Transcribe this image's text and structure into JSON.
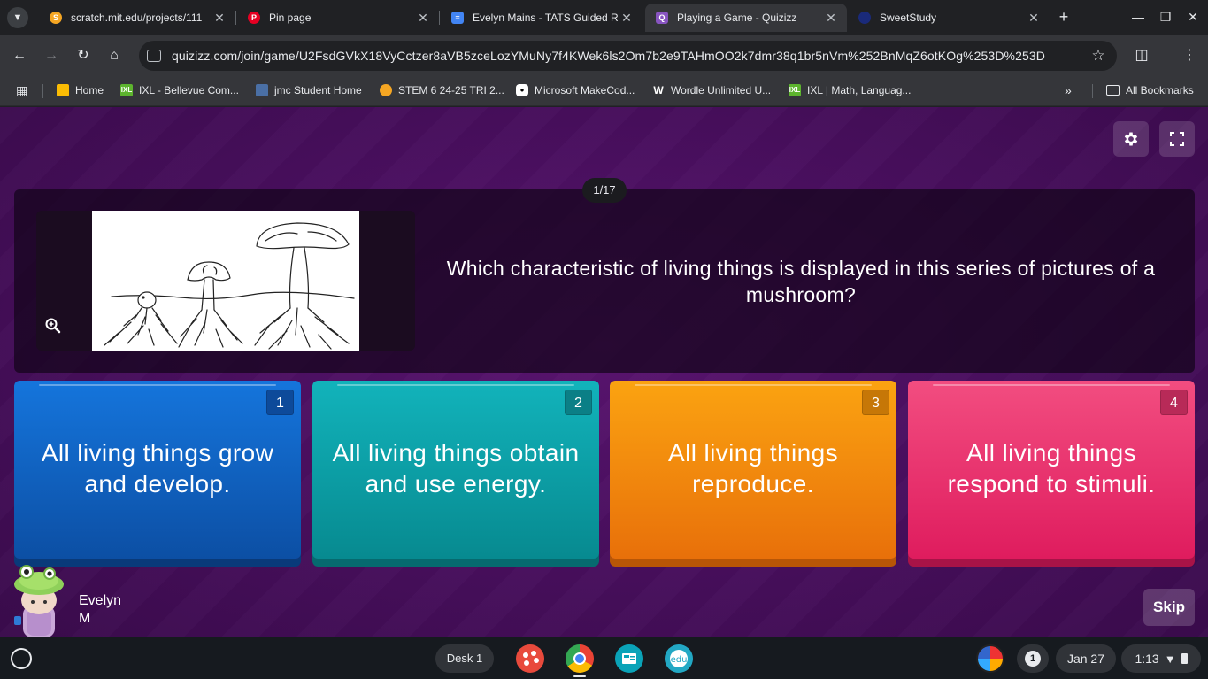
{
  "browser": {
    "tabs": [
      {
        "title": "scratch.mit.edu/projects/111",
        "favicon_color": "#f5a623",
        "active": false
      },
      {
        "title": "Pin page",
        "favicon_color": "#e60023",
        "active": false
      },
      {
        "title": "Evelyn Mains - TATS Guided R",
        "favicon_color": "#4285f4",
        "active": false
      },
      {
        "title": "Playing a Game - Quizizz",
        "favicon_color": "#8854c0",
        "active": true
      },
      {
        "title": "SweetStudy",
        "favicon_color": "#1a2a7a",
        "active": false
      }
    ],
    "url": "quizizz.com/join/game/U2FsdGVkX18VyCctzer8aVB5zceLozYMuNy7f4KWek6ls2Om7b2e9TAHmOO2k7dmr38q1br5nVm%252BnMqZ6otKOg%253D%253D",
    "bookmarks": [
      {
        "label": "Home",
        "icon_color": "#fbbc04"
      },
      {
        "label": "IXL - Bellevue Com...",
        "icon_color": "#5db42e"
      },
      {
        "label": "jmc Student Home",
        "icon_color": "#4a6fa5"
      },
      {
        "label": "STEM 6 24-25 TRI 2...",
        "icon_color": "#f5a623"
      },
      {
        "label": "Microsoft MakeCod...",
        "icon_color": "#ffffff"
      },
      {
        "label": "Wordle Unlimited U...",
        "icon_color": "#000000"
      },
      {
        "label": "IXL | Math, Languag...",
        "icon_color": "#5db42e"
      }
    ],
    "all_bookmarks": "All Bookmarks"
  },
  "quiz": {
    "counter": "1/17",
    "question": "Which characteristic of living things is displayed in this series of pictures of a mushroom?",
    "options": [
      {
        "number": "1",
        "text": "All living things grow and develop.",
        "color": "#1266c9",
        "num_bg": "#0d4a9a"
      },
      {
        "number": "2",
        "text": "All living things obtain and use energy.",
        "color": "#0ea9b0",
        "num_bg": "#0b7f86"
      },
      {
        "number": "3",
        "text": "All living things reproduce.",
        "color": "#f59a0b",
        "num_bg": "#c67707"
      },
      {
        "number": "4",
        "text": "All living things respond to stimuli.",
        "color": "#ec3f76",
        "num_bg": "#b82a58"
      }
    ],
    "player": {
      "first": "Evelyn",
      "last": "M"
    },
    "skip_label": "Skip"
  },
  "shelf": {
    "desk_label": "Desk 1",
    "notification_count": "1",
    "date": "Jan 27",
    "time": "1:13"
  }
}
